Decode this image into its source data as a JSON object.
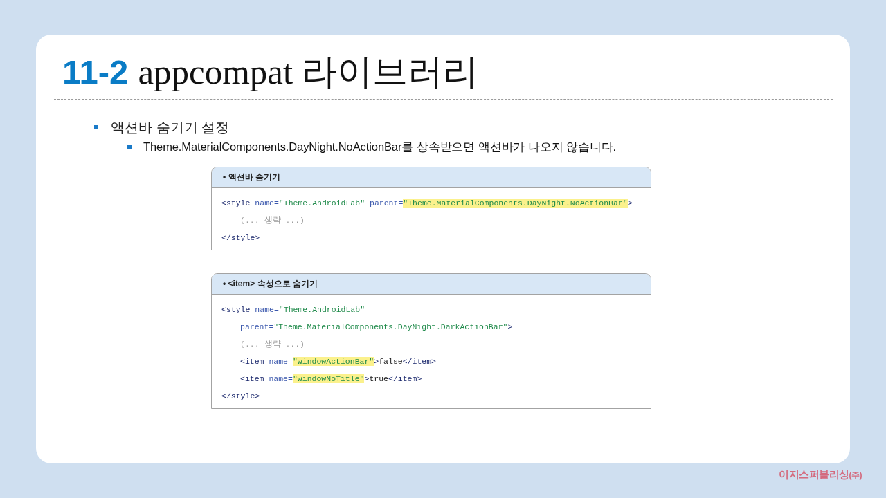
{
  "title": {
    "number": "11-2",
    "text": "appcompat 라이브러리"
  },
  "bullets": [
    {
      "text": "액션바 숨기기 설정",
      "children": [
        {
          "text": "Theme.MaterialComponents.DayNight.NoActionBar를 상속받으면 액션바가 나오지 않습니다."
        }
      ]
    }
  ],
  "code_boxes": [
    {
      "heading": "• 액션바 숨기기",
      "lines": [
        {
          "tokens": [
            {
              "kind": "tag",
              "text": "<style"
            },
            {
              "kind": "attr",
              "text": " name="
            },
            {
              "kind": "string",
              "text": "\"Theme.AndroidLab\""
            },
            {
              "kind": "attr",
              "text": " parent="
            },
            {
              "kind": "highlighted_string",
              "text": "\"Theme.MaterialComponents.DayNight.NoActionBar\""
            },
            {
              "kind": "tag",
              "text": ">"
            }
          ],
          "children": [
            {
              "tokens": [
                {
                  "kind": "comment",
                  "text": "(... 생략 ...)"
                }
              ]
            }
          ]
        },
        {
          "tokens": [
            {
              "kind": "tag",
              "text": "</style>"
            }
          ]
        }
      ]
    },
    {
      "heading": "• <item> 속성으로 숨기기",
      "lines": [
        {
          "tokens": [
            {
              "kind": "tag",
              "text": "<style"
            },
            {
              "kind": "attr",
              "text": " name="
            },
            {
              "kind": "string",
              "text": "\"Theme.AndroidLab\""
            }
          ],
          "children": [
            {
              "tokens": [
                {
                  "kind": "attr",
                  "text": "parent="
                },
                {
                  "kind": "string",
                  "text": "\"Theme.MaterialComponents.DayNight.DarkActionBar\""
                },
                {
                  "kind": "tag",
                  "text": ">"
                }
              ]
            },
            {
              "tokens": [
                {
                  "kind": "comment",
                  "text": "(... 생략 ...)"
                }
              ]
            },
            {
              "tokens": [
                {
                  "kind": "tag",
                  "text": "<item"
                },
                {
                  "kind": "attr",
                  "text": " name="
                },
                {
                  "kind": "highlighted_string",
                  "text": "\"windowActionBar\""
                },
                {
                  "kind": "tag",
                  "text": ">"
                },
                {
                  "kind": "text",
                  "text": "false"
                },
                {
                  "kind": "tag",
                  "text": "</item>"
                }
              ]
            },
            {
              "tokens": [
                {
                  "kind": "tag",
                  "text": "<item"
                },
                {
                  "kind": "attr",
                  "text": " name="
                },
                {
                  "kind": "highlighted_string",
                  "text": "\"windowNoTitle\""
                },
                {
                  "kind": "tag",
                  "text": ">"
                },
                {
                  "kind": "text",
                  "text": "true"
                },
                {
                  "kind": "tag",
                  "text": "</item>"
                }
              ]
            }
          ]
        },
        {
          "tokens": [
            {
              "kind": "tag",
              "text": "</style>"
            }
          ]
        }
      ]
    }
  ],
  "publisher": {
    "name": "이지스퍼블리싱",
    "suffix": "(주)"
  }
}
